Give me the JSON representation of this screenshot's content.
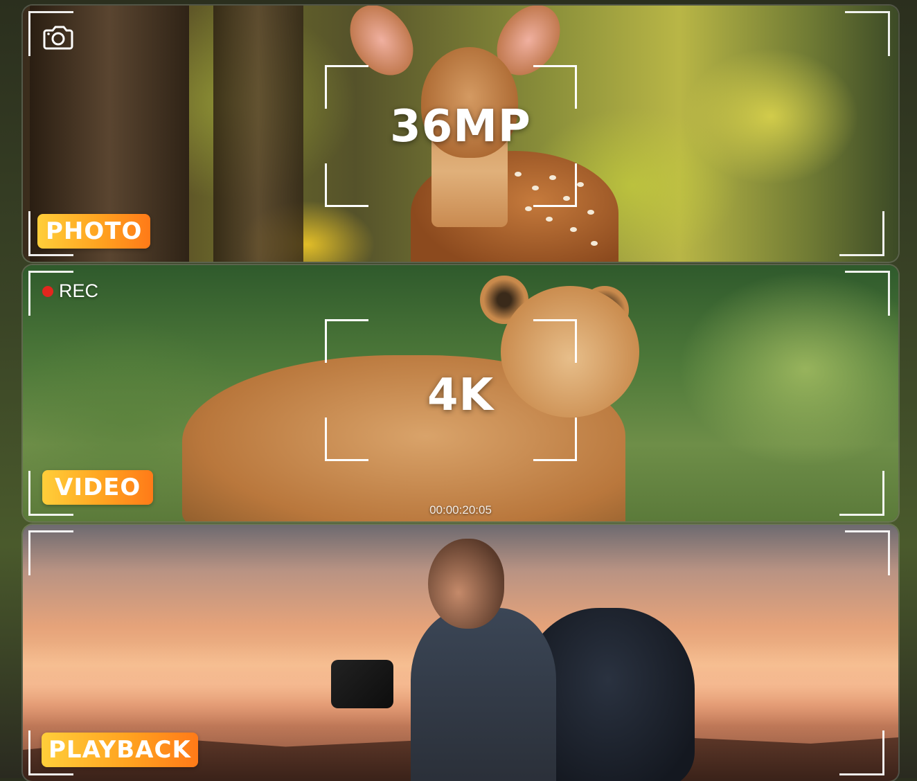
{
  "panels": {
    "photo": {
      "headline": "36MP",
      "mode_label": "PHOTO",
      "icon": "camera-icon"
    },
    "video": {
      "headline": "4K",
      "mode_label": "VIDEO",
      "rec_label": "REC",
      "timecode": "00:00:20:05"
    },
    "playback": {
      "mode_label": "PLAYBACK"
    }
  },
  "colors": {
    "badge_gradient_start": "#ffce3a",
    "badge_gradient_end": "#ff7a18",
    "rec_dot": "#e3261e"
  }
}
